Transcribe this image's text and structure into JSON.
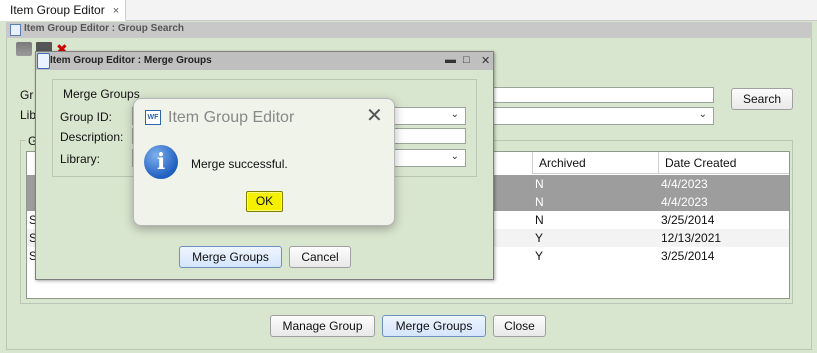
{
  "app": {
    "tab_title": "Item Group Editor",
    "tab_close": "×",
    "frame_title": "Item Group Editor : Group Search"
  },
  "background": {
    "group_label": "Gr",
    "library_label": "Lib",
    "section_label": "G",
    "search_button": "Search",
    "columns": [
      "Archived",
      "Date Created"
    ],
    "rows": [
      {
        "prefix": "",
        "archived": "N",
        "date": "4/4/2023",
        "selected": true
      },
      {
        "prefix": "",
        "archived": "N",
        "date": "4/4/2023",
        "selected": true
      },
      {
        "prefix": "S",
        "archived": "N",
        "date": "3/25/2014",
        "selected": false
      },
      {
        "prefix": "S",
        "archived": "Y",
        "date": "12/13/2021",
        "selected": false
      },
      {
        "prefix": "S",
        "archived": "Y",
        "date": "3/25/2014",
        "selected": false
      }
    ],
    "buttons": {
      "manage": "Manage Group",
      "merge": "Merge Groups",
      "close": "Close"
    }
  },
  "merge_dialog": {
    "title": "Item Group Editor : Merge Groups",
    "minimize": "▬",
    "maximize": "□",
    "close": "✕",
    "legend": "Merge Groups",
    "group_id_label": "Group ID:",
    "description_label": "Description:",
    "library_label": "Library:",
    "merge_button": "Merge Groups",
    "cancel_button": "Cancel"
  },
  "message_box": {
    "title": "Item Group Editor",
    "icon_text": "WF",
    "close": "✕",
    "info_glyph": "i",
    "text": "Merge successful.",
    "ok": "OK"
  }
}
